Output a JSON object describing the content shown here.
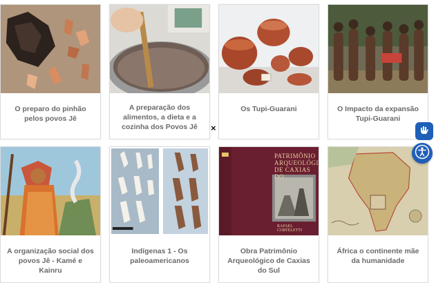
{
  "cards": [
    {
      "title": "O preparo do pinhão pelos povos Jê"
    },
    {
      "title": "A preparação dos alimentos, a dieta e a cozinha dos Povos Jê"
    },
    {
      "title": "Os Tupi-Guarani"
    },
    {
      "title": "O Impacto da expansão Tupi-Guarani"
    },
    {
      "title": "A organização social dos povos Jê - Kamé e Kainru"
    },
    {
      "title": "Indígenas 1 - Os paleoamericanos"
    },
    {
      "title": "Obra Patrimônio Arqueológico de Caxias do Sul"
    },
    {
      "title": "África o continente mãe da humanidade"
    }
  ],
  "book_cover": {
    "line1": "PATRIMÔNIO",
    "line2": "ARQUEOLÓGICO",
    "line3": "DE CAXIAS DO",
    "author": "RAFAEL CORTELETTI"
  },
  "close_glyph": "×",
  "widgets": {
    "sign_language_icon": "hand-sign-icon",
    "accessibility_icon": "accessibility-icon"
  }
}
